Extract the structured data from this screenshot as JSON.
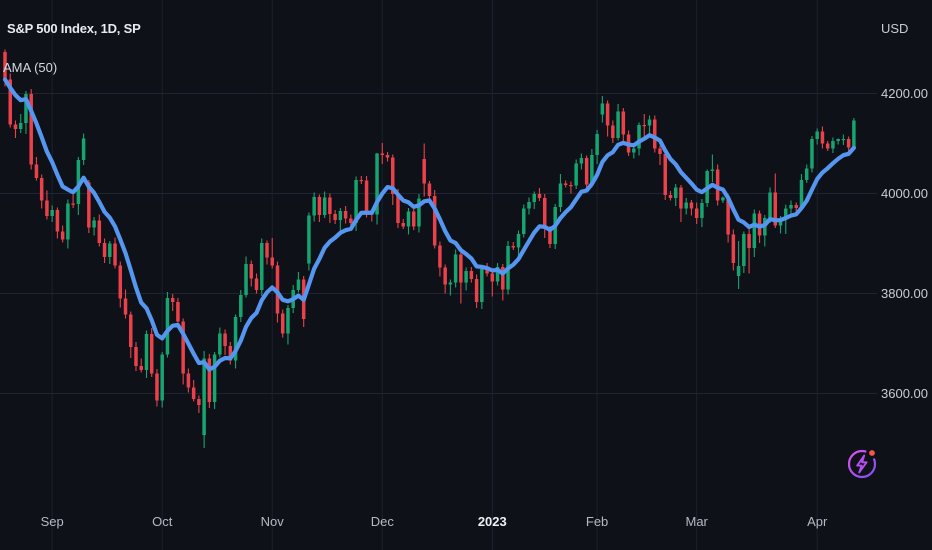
{
  "legend": {
    "symbol_title": "S&P 500 Index, 1D, SP",
    "indicator_label": "AMA (50)"
  },
  "price_axis": {
    "currency_label": "USD",
    "ticks": [
      {
        "price": 4200,
        "label": "4200.00"
      },
      {
        "price": 4000,
        "label": "4000.00"
      },
      {
        "price": 3800,
        "label": "3800.00"
      },
      {
        "price": 3600,
        "label": "3600.00"
      }
    ]
  },
  "time_axis": {
    "ticks": [
      {
        "label": "Sep",
        "bar": 9,
        "bold": false
      },
      {
        "label": "Oct",
        "bar": 30,
        "bold": false
      },
      {
        "label": "Nov",
        "bar": 51,
        "bold": false
      },
      {
        "label": "Dec",
        "bar": 72,
        "bold": false
      },
      {
        "label": "2023",
        "bar": 93,
        "bold": true
      },
      {
        "label": "Feb",
        "bar": 113,
        "bold": false
      },
      {
        "label": "Mar",
        "bar": 132,
        "bold": false
      },
      {
        "label": "Apr",
        "bar": 155,
        "bold": false
      }
    ]
  },
  "boost_button": {
    "icon": "lightning-bolt-icon",
    "notification_dot": true
  },
  "colors": {
    "background": "#0e1118",
    "candle_up": "#16a470",
    "candle_down": "#eb414b",
    "ma_line": "#5596f0",
    "grid_h": "#1d2433",
    "grid_v": "#1a2130",
    "axis_text": "#b4b9c4",
    "bright_text": "#eef0f3",
    "icon_gradient_start": "#e052f0",
    "icon_gradient_end": "#7d4ff2",
    "icon_bolt": "#b54ff2",
    "badge_dot": "#f5554a"
  },
  "chart_data": {
    "type": "candlestick",
    "title": "S&P 500 Index, 1D, SP",
    "interval": "1D",
    "overlay_line": {
      "label": "AMA (50)",
      "type": "line"
    },
    "ylim": [
      3290,
      4385
    ],
    "price_gridlines": [
      4200,
      4000,
      3800,
      3600
    ],
    "candles": [
      [
        4283,
        4288,
        4214,
        4228
      ],
      [
        4228,
        4240,
        4132,
        4138
      ],
      [
        4138,
        4146,
        4111,
        4129
      ],
      [
        4129,
        4159,
        4121,
        4141
      ],
      [
        4141,
        4205,
        4119,
        4199
      ],
      [
        4199,
        4209,
        4048,
        4058
      ],
      [
        4058,
        4073,
        4026,
        4031
      ],
      [
        4031,
        4038,
        3970,
        3986
      ],
      [
        3986,
        4006,
        3948,
        3955
      ],
      [
        3955,
        3976,
        3943,
        3967
      ],
      [
        3967,
        3972,
        3910,
        3924
      ],
      [
        3924,
        3936,
        3902,
        3908
      ],
      [
        3908,
        3988,
        3890,
        3980
      ],
      [
        3980,
        3998,
        3971,
        3979
      ],
      [
        3979,
        4073,
        3957,
        4067
      ],
      [
        4067,
        4120,
        4057,
        4110
      ],
      [
        4022,
        4027,
        3921,
        3932
      ],
      [
        3932,
        3953,
        3916,
        3946
      ],
      [
        3946,
        3958,
        3894,
        3901
      ],
      [
        3901,
        3910,
        3861,
        3873
      ],
      [
        3873,
        3905,
        3859,
        3900
      ],
      [
        3900,
        3912,
        3850,
        3856
      ],
      [
        3856,
        3864,
        3772,
        3790
      ],
      [
        3790,
        3808,
        3750,
        3758
      ],
      [
        3758,
        3764,
        3671,
        3693
      ],
      [
        3693,
        3703,
        3645,
        3655
      ],
      [
        3655,
        3670,
        3642,
        3647
      ],
      [
        3647,
        3726,
        3631,
        3719
      ],
      [
        3719,
        3731,
        3633,
        3640
      ],
      [
        3640,
        3649,
        3574,
        3586
      ],
      [
        3586,
        3683,
        3572,
        3678
      ],
      [
        3678,
        3803,
        3672,
        3791
      ],
      [
        3791,
        3799,
        3765,
        3783
      ],
      [
        3783,
        3791,
        3736,
        3744
      ],
      [
        3744,
        3750,
        3618,
        3640
      ],
      [
        3640,
        3650,
        3602,
        3612
      ],
      [
        3612,
        3627,
        3584,
        3589
      ],
      [
        3589,
        3596,
        3561,
        3577
      ],
      [
        3517,
        3685,
        3491,
        3670
      ],
      [
        3670,
        3679,
        3571,
        3583
      ],
      [
        3583,
        3683,
        3569,
        3678
      ],
      [
        3678,
        3732,
        3672,
        3720
      ],
      [
        3720,
        3728,
        3677,
        3695
      ],
      [
        3695,
        3703,
        3658,
        3666
      ],
      [
        3666,
        3758,
        3650,
        3753
      ],
      [
        3753,
        3807,
        3743,
        3797
      ],
      [
        3797,
        3874,
        3792,
        3859
      ],
      [
        3859,
        3866,
        3814,
        3830
      ],
      [
        3830,
        3840,
        3800,
        3807
      ],
      [
        3807,
        3910,
        3795,
        3901
      ],
      [
        3901,
        3906,
        3858,
        3872
      ],
      [
        3872,
        3911,
        3850,
        3856
      ],
      [
        3856,
        3864,
        3742,
        3760
      ],
      [
        3760,
        3768,
        3712,
        3720
      ],
      [
        3720,
        3777,
        3698,
        3771
      ],
      [
        3771,
        3817,
        3761,
        3807
      ],
      [
        3807,
        3843,
        3802,
        3828
      ],
      [
        3828,
        3835,
        3733,
        3749
      ],
      [
        3860,
        3962,
        3846,
        3956
      ],
      [
        3956,
        4002,
        3944,
        3993
      ],
      [
        3993,
        3998,
        3943,
        3957
      ],
      [
        3957,
        4004,
        3951,
        3992
      ],
      [
        3992,
        4000,
        3941,
        3959
      ],
      [
        3959,
        3967,
        3939,
        3947
      ],
      [
        3947,
        3971,
        3925,
        3965
      ],
      [
        3965,
        3975,
        3940,
        3950
      ],
      [
        3950,
        3958,
        3936,
        3941
      ],
      [
        3941,
        4034,
        3925,
        4027
      ],
      [
        4027,
        4035,
        4019,
        4026
      ],
      [
        4026,
        4035,
        3952,
        3964
      ],
      [
        3964,
        3969,
        3944,
        3958
      ],
      [
        3958,
        4081,
        3938,
        4080
      ],
      [
        4080,
        4101,
        4059,
        4077
      ],
      [
        4077,
        4083,
        4064,
        4072
      ],
      [
        4072,
        4078,
        3977,
        3999
      ],
      [
        3999,
        4009,
        3931,
        3941
      ],
      [
        3941,
        3949,
        3929,
        3934
      ],
      [
        3934,
        3971,
        3918,
        3964
      ],
      [
        3964,
        3972,
        3927,
        3934
      ],
      [
        3934,
        3999,
        3922,
        3990
      ],
      [
        4069,
        4100,
        3994,
        4020
      ],
      [
        4020,
        4025,
        3981,
        3995
      ],
      [
        3995,
        4007,
        3890,
        3896
      ],
      [
        3896,
        3904,
        3834,
        3852
      ],
      [
        3852,
        3858,
        3800,
        3818
      ],
      [
        3818,
        3828,
        3796,
        3822
      ],
      [
        3822,
        3888,
        3812,
        3878
      ],
      [
        3878,
        3884,
        3780,
        3822
      ],
      [
        3822,
        3852,
        3806,
        3845
      ],
      [
        3845,
        3853,
        3822,
        3829
      ],
      [
        3829,
        3838,
        3771,
        3783
      ],
      [
        3783,
        3854,
        3769,
        3849
      ],
      [
        3849,
        3861,
        3834,
        3840
      ],
      [
        3840,
        3848,
        3794,
        3824
      ],
      [
        3824,
        3861,
        3816,
        3853
      ],
      [
        3853,
        3859,
        3786,
        3808
      ],
      [
        3808,
        3905,
        3798,
        3895
      ],
      [
        3895,
        3903,
        3887,
        3892
      ],
      [
        3892,
        3926,
        3876,
        3919
      ],
      [
        3919,
        3978,
        3912,
        3970
      ],
      [
        3970,
        3992,
        3958,
        3983
      ],
      [
        3983,
        4004,
        3969,
        3999
      ],
      [
        3999,
        4011,
        3985,
        3991
      ],
      [
        3991,
        3999,
        3911,
        3929
      ],
      [
        3929,
        3935,
        3891,
        3899
      ],
      [
        3899,
        3979,
        3889,
        3973
      ],
      [
        3973,
        4039,
        3963,
        4020
      ],
      [
        4020,
        4026,
        4012,
        4017
      ],
      [
        4017,
        4024,
        4000,
        4016
      ],
      [
        4016,
        4068,
        4009,
        4060
      ],
      [
        4060,
        4080,
        4048,
        4071
      ],
      [
        4071,
        4076,
        4004,
        4018
      ],
      [
        4018,
        4089,
        4012,
        4077
      ],
      [
        4077,
        4127,
        4059,
        4119
      ],
      [
        4158,
        4195,
        4142,
        4180
      ],
      [
        4180,
        4186,
        4114,
        4136
      ],
      [
        4136,
        4146,
        4101,
        4111
      ],
      [
        4111,
        4179,
        4106,
        4164
      ],
      [
        4164,
        4171,
        4102,
        4118
      ],
      [
        4118,
        4126,
        4075,
        4082
      ],
      [
        4082,
        4099,
        4070,
        4090
      ],
      [
        4090,
        4142,
        4076,
        4137
      ],
      [
        4137,
        4159,
        4111,
        4136
      ],
      [
        4136,
        4156,
        4118,
        4148
      ],
      [
        4148,
        4156,
        4082,
        4090
      ],
      [
        4090,
        4096,
        4057,
        4079
      ],
      [
        4079,
        4089,
        3987,
        3997
      ],
      [
        3997,
        4005,
        3986,
        3991
      ],
      [
        3991,
        4019,
        3975,
        4012
      ],
      [
        4012,
        4017,
        3943,
        3970
      ],
      [
        3970,
        3991,
        3958,
        3982
      ],
      [
        3982,
        3987,
        3956,
        3970
      ],
      [
        3970,
        3982,
        3939,
        3951
      ],
      [
        3951,
        3989,
        3933,
        3981
      ],
      [
        3981,
        4048,
        3973,
        4045
      ],
      [
        4045,
        4078,
        4023,
        4048
      ],
      [
        4048,
        4058,
        3976,
        3986
      ],
      [
        3986,
        3994,
        3981,
        3992
      ],
      [
        3992,
        3999,
        3902,
        3918
      ],
      [
        3918,
        3928,
        3846,
        3861
      ],
      [
        3835,
        3905,
        3809,
        3855
      ],
      [
        3855,
        3924,
        3841,
        3919
      ],
      [
        3919,
        3931,
        3840,
        3891
      ],
      [
        3891,
        3968,
        3873,
        3960
      ],
      [
        3960,
        3966,
        3901,
        3916
      ],
      [
        3916,
        3957,
        3894,
        3951
      ],
      [
        3951,
        4012,
        3941,
        4002
      ],
      [
        4002,
        4040,
        3931,
        3936
      ],
      [
        3936,
        3955,
        3920,
        3948
      ],
      [
        3948,
        3978,
        3919,
        3970
      ],
      [
        3970,
        3986,
        3958,
        3977
      ],
      [
        3977,
        3982,
        3957,
        3971
      ],
      [
        3971,
        4039,
        3965,
        4027
      ],
      [
        4027,
        4058,
        4021,
        4050
      ],
      [
        4050,
        4115,
        4042,
        4109
      ],
      [
        4109,
        4130,
        4098,
        4124
      ],
      [
        4124,
        4134,
        4090,
        4100
      ],
      [
        4100,
        4105,
        4085,
        4090
      ],
      [
        4090,
        4112,
        4081,
        4105
      ],
      [
        4105,
        4110,
        4098,
        4109
      ],
      [
        4109,
        4118,
        4097,
        4109
      ],
      [
        4109,
        4114,
        4078,
        4092
      ],
      [
        4092,
        4151,
        4086,
        4146
      ]
    ]
  }
}
